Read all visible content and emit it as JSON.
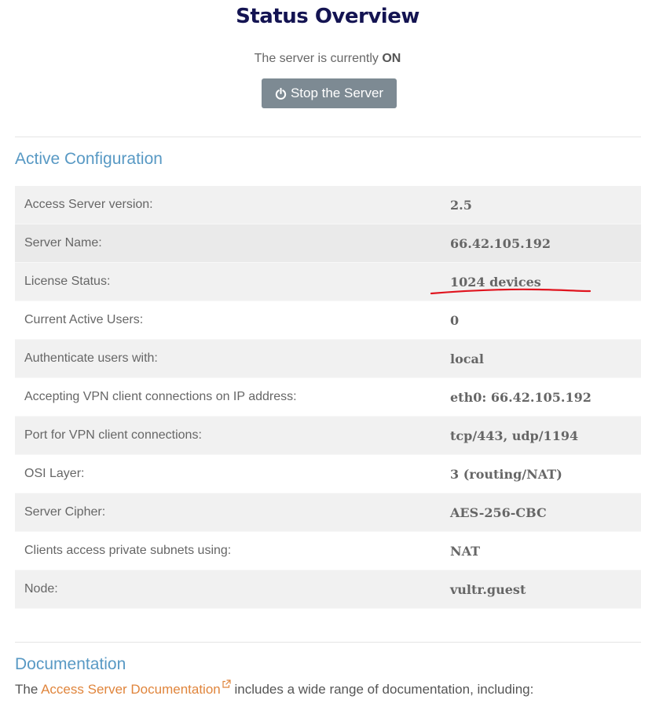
{
  "header": {
    "title": "Status Overview",
    "status_prefix": "The server is currently",
    "status_value": "ON",
    "stop_button_label": "Stop the Server"
  },
  "active_config": {
    "heading": "Active Configuration",
    "rows": [
      {
        "label": "Access Server version:",
        "value": "2.5"
      },
      {
        "label": "Server Name:",
        "value": "66.42.105.192"
      },
      {
        "label": "License Status:",
        "value": "1024 devices"
      },
      {
        "label": "Current Active Users:",
        "value": "0"
      },
      {
        "label": "Authenticate users with:",
        "value": "local"
      },
      {
        "label": "Accepting VPN client connections on IP address:",
        "value": "eth0: 66.42.105.192"
      },
      {
        "label": "Port for VPN client connections:",
        "value": "tcp/443, udp/1194"
      },
      {
        "label": "OSI Layer:",
        "value": "3 (routing/NAT)"
      },
      {
        "label": "Server Cipher:",
        "value": "AES-256-CBC"
      },
      {
        "label": "Clients access private subnets using:",
        "value": "NAT"
      },
      {
        "label": "Node:",
        "value": "vultr.guest"
      }
    ]
  },
  "documentation": {
    "heading": "Documentation",
    "prefix": "The",
    "link_text": "Access Server Documentation",
    "suffix": "includes a wide range of documentation, including:"
  },
  "colors": {
    "title": "#141452",
    "section_heading": "#5899c4",
    "button_bg": "#7d8a93",
    "link": "#e0853c",
    "annotation": "#e0141e"
  },
  "icons": {
    "stop_button": "power-icon",
    "doc_link": "external-link-icon"
  }
}
